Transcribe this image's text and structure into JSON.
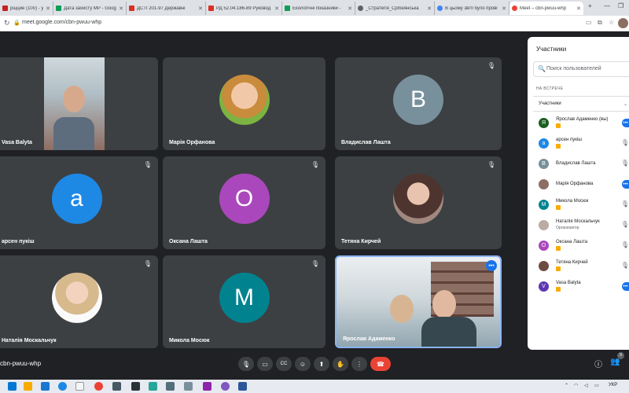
{
  "browser": {
    "tabs": [
      {
        "title": "рщцие (100) - yarad1",
        "color": "#c5221f"
      },
      {
        "title": "Дата захисту МР - Googl",
        "color": "#0f9d58"
      },
      {
        "title": "ДСТІ 201-97 Державні",
        "color": "#d93025"
      },
      {
        "title": "РД 52.04.186-89 Руковод",
        "color": "#d93025"
      },
      {
        "title": "Екологічні показники -",
        "color": "#0f9d58"
      },
      {
        "title": "_Стратегія_Срібнянська",
        "color": "#5f6368"
      },
      {
        "title": "В цьому звіті було прові",
        "color": "#4285f4"
      },
      {
        "title": "Meet – cbn-pwuu-whp",
        "color": "#ea4335"
      }
    ],
    "url": "meet.google.com/cbn-pwuu-whp"
  },
  "tiles": [
    {
      "name": "Vasa Balyta",
      "mic": "",
      "avatar": "",
      "color": ""
    },
    {
      "name": "Марія Орфанова",
      "mic": "",
      "avatar": "",
      "color": ""
    },
    {
      "name": "Владислав Лашта",
      "mic": "🎙",
      "avatar": "B",
      "color": "#78909c"
    },
    {
      "name": "арсен пукіш",
      "mic": "🎙",
      "avatar": "a",
      "color": "#1e88e5"
    },
    {
      "name": "Оксана Лашта",
      "mic": "🎙",
      "avatar": "O",
      "color": "#ab47bc"
    },
    {
      "name": "Тетяна Кирчей",
      "mic": "🎙",
      "avatar": "",
      "color": ""
    },
    {
      "name": "Наталія Москальчук",
      "mic": "🎙",
      "avatar": "",
      "color": ""
    },
    {
      "name": "Микола Мосюк",
      "mic": "🎙",
      "avatar": "M",
      "color": "#00838f"
    },
    {
      "name": "Ярослав Адаменко",
      "mic": "",
      "avatar": "",
      "color": ""
    }
  ],
  "meeting_code": "cbn-pwuu-whp",
  "panel": {
    "title": "Участники",
    "search_placeholder": "Поиск пользователей",
    "section": "НА ВСТРЕЧЕ",
    "subheader": "Участники",
    "participants": [
      {
        "name": "Ярослав Адаменко (вы)",
        "initial": "Я",
        "color": "#1b5e20",
        "sub": ""
      },
      {
        "name": "арсен пукіш",
        "initial": "a",
        "color": "#1e88e5",
        "sub": ""
      },
      {
        "name": "Владислав Лашта",
        "initial": "B",
        "color": "#78909c",
        "sub": ""
      },
      {
        "name": "Марія Орфанова",
        "initial": "",
        "color": "#8d6e63",
        "sub": ""
      },
      {
        "name": "Микола Мосюк",
        "initial": "M",
        "color": "#00838f",
        "sub": ""
      },
      {
        "name": "Наталія Москальчук",
        "initial": "",
        "color": "#bcaaa4",
        "sub": "Организатор"
      },
      {
        "name": "Оксана Лашта",
        "initial": "O",
        "color": "#ab47bc",
        "sub": ""
      },
      {
        "name": "Тетяна Кирчей",
        "initial": "",
        "color": "#6d4c41",
        "sub": ""
      },
      {
        "name": "Vasa Balyta",
        "initial": "V",
        "color": "#5e35b1",
        "sub": ""
      }
    ]
  },
  "taskbar": {
    "lang": "УКР",
    "badge": "9"
  }
}
